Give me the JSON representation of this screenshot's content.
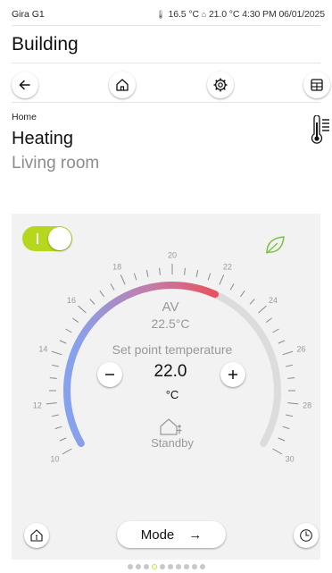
{
  "status": {
    "device_name": "Gira G1",
    "outdoor_temp": "16.5 °C",
    "indoor_temp": "21.0 °C",
    "time": "4:30 PM",
    "date": "06/01/2025"
  },
  "header": {
    "title": "Building"
  },
  "navbar": {
    "icons": [
      "back-arrow-icon",
      "home-icon",
      "settings-gear-icon",
      "grid-view-icon"
    ]
  },
  "breadcrumb": "Home",
  "function": {
    "title": "Heating",
    "room": "Living room"
  },
  "thermostat": {
    "on": true,
    "eco_mode": true,
    "actual_label": "AV",
    "actual_value": "22.5°C",
    "setpoint_label": "Set point temperature",
    "setpoint_value": "22.0",
    "unit": "°C",
    "mode_status": "Standby",
    "scale_labels": [
      "10",
      "12",
      "14",
      "16",
      "18",
      "20",
      "22",
      "24",
      "26",
      "28",
      "30"
    ],
    "scale_min": 10,
    "scale_max": 30,
    "setpoint_numeric": 22.0,
    "colors": {
      "cold": "#86a2ee",
      "warm": "#e8525f",
      "track": "#dcdcdc",
      "accent": "#b5d81f",
      "leaf": "#7cc242"
    }
  },
  "bottom": {
    "mode_label": "Mode",
    "mode_arrow": "→"
  },
  "pager": {
    "count": 10,
    "active_index": 3
  }
}
